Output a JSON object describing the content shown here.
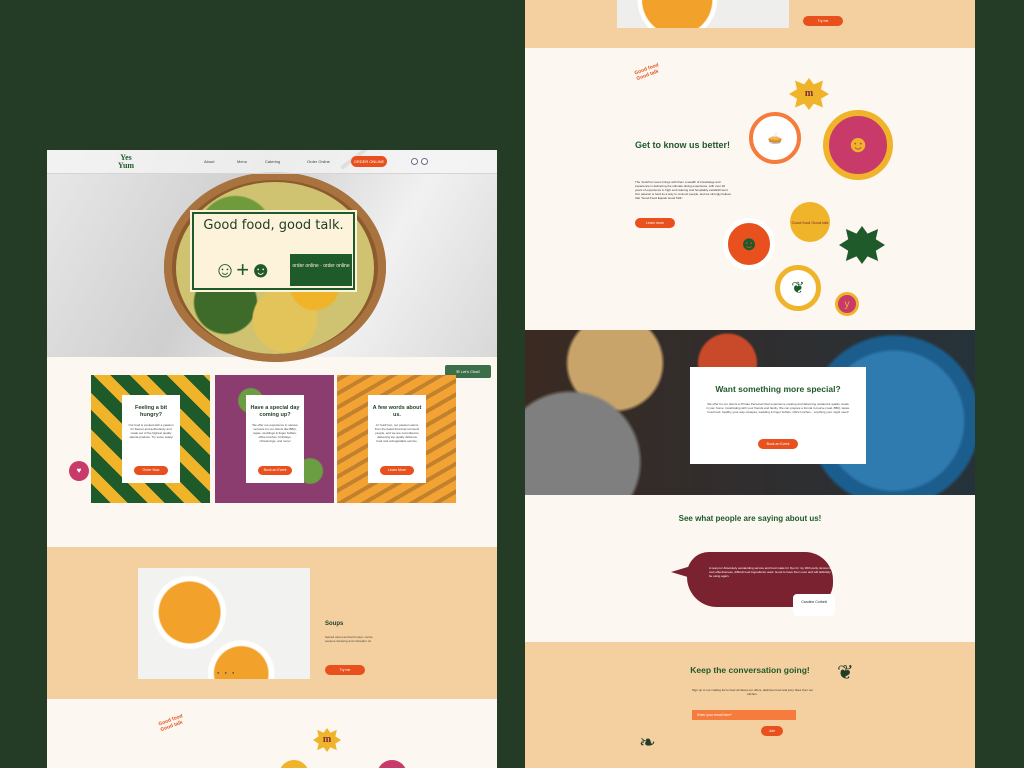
{
  "colors": {
    "background": "#243b26",
    "accent": "#e8501d",
    "brand_green": "#1f5a2a",
    "peach": "#f4d0a0",
    "wine": "#7a2230"
  },
  "header": {
    "logo": "Yes Yum",
    "nav": [
      "About",
      "Menu",
      "Catering",
      "Order Online"
    ],
    "order_button": "ORDER ONLINE",
    "icons": [
      "instagram-icon",
      "facebook-icon"
    ]
  },
  "hero": {
    "title": "Good food, good talk.",
    "badge": "order online · order online"
  },
  "chat_button": "Let's Chat!",
  "tiles": [
    {
      "title": "Feeling a bit hungry?",
      "text": "Our food is cooked with a passion for flavour and authenticity and made out of the highest quality natural produce. Try some today!",
      "button": "Order Now"
    },
    {
      "title": "Have a special day coming up?",
      "text": "We offer our experience in various services for our clients like BBQ, tapas, weddings & finger buffets, office lunches, birthdays, christenings, and more!",
      "button": "Book an Event"
    },
    {
      "title": "A few words about us.",
      "text": "At Yes&Yum, our passion stems from the belief that food connects people, and we are committed to delivering top quality delicious food and unforgettable service.",
      "button": "Learn More"
    }
  ],
  "soup": {
    "title": "Soups",
    "description": "Spiced carrot and lentil soup, carrot-sesame dressing and coriander oil.",
    "button": "Try me",
    "dots": "● ● ●"
  },
  "seals": {
    "text": "Good food Good talk",
    "m": "m",
    "y": "y"
  },
  "about": {
    "title": "Get to know us better!",
    "text": "The Yes&Yum team brings with them a wealth of knowledge and experience in delivering the ultimate dining experience, with over 20 years of experience in high end catering and hospitality establishment. Our passion is food as a way to connect people, and we strongly believe that \"Good Food Equals Good Talk\".",
    "button": "Learn more"
  },
  "special": {
    "title": "Want something more special?",
    "text": "We offer for our clients a Private Personal Chef experience cooking and delivering restaurant quality meals in your home. Celebrating with your friends and family. We can prepare a formal 3-course meal, BBQ, tapas, bowl food, healthy-your-way canapés, wedding & finger buffets, office lunches... anything your might need!",
    "button": "Book an Event"
  },
  "testimonials": {
    "title": "See what people are saying about us!",
    "quote": "A real pro! Absolutely outstanding service and food made for 9yo for my 30th party. Economy, cost effectiveness, difficult loud Ingredients used. Good to have them over and will definitely be using again.",
    "author": "Caroline Corbett"
  },
  "newsletter": {
    "title": "Keep the conversation going!",
    "text": "Sign up to our mailing list to hear all about our offers, delicious food and juicy bites from our kitchen.",
    "placeholder": "Enter your email here*",
    "button": "Join"
  }
}
